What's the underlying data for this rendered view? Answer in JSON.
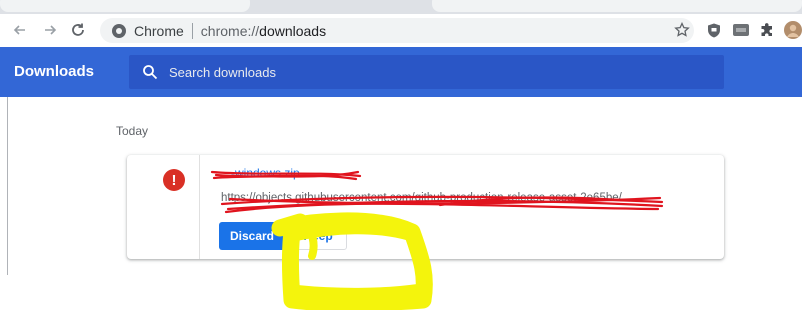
{
  "browser": {
    "site_name": "Chrome",
    "url_scheme": "chrome://",
    "url_host": "downloads"
  },
  "header": {
    "title": "Downloads",
    "search_placeholder": "Search downloads"
  },
  "main": {
    "section_label": "Today",
    "download": {
      "status": "error",
      "file_name": "...-windows.zip",
      "url": "https://objects.githubusercontent.com/github-production-release-asset-2e65be/...",
      "buttons": {
        "discard": "Discard",
        "keep": "Keep"
      }
    }
  },
  "colors": {
    "header_bg": "#3367d6",
    "primary_button": "#1a73e8",
    "error_icon": "#d93025",
    "scribble_red": "#e0141e",
    "highlight_yellow": "#f4f40c"
  }
}
